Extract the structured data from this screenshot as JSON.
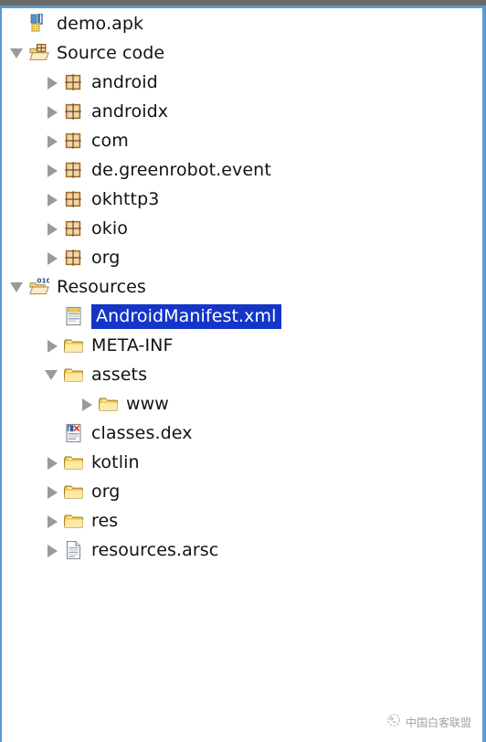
{
  "window": {
    "title": "demo.apk",
    "accent_color": "#5b9bd5",
    "titlebar_color": "#6a6a6a",
    "background": "#ffffff"
  },
  "selection": {
    "highlight_color": "#1535c8",
    "text_color": "#ffffff",
    "selected_label": "AndroidManifest.xml"
  },
  "tree": {
    "rows": [
      {
        "label": "demo.apk",
        "icon": "apk-file-icon",
        "depth": 0,
        "twisty": "none",
        "selected": false
      },
      {
        "label": "Source code",
        "icon": "package-folder-open-icon",
        "depth": 0,
        "twisty": "expanded",
        "selected": false
      },
      {
        "label": "android",
        "icon": "package-icon",
        "depth": 1,
        "twisty": "collapsed",
        "selected": false
      },
      {
        "label": "androidx",
        "icon": "package-icon",
        "depth": 1,
        "twisty": "collapsed",
        "selected": false
      },
      {
        "label": "com",
        "icon": "package-icon",
        "depth": 1,
        "twisty": "collapsed",
        "selected": false
      },
      {
        "label": "de.greenrobot.event",
        "icon": "package-icon",
        "depth": 1,
        "twisty": "collapsed",
        "selected": false
      },
      {
        "label": "okhttp3",
        "icon": "package-icon",
        "depth": 1,
        "twisty": "collapsed",
        "selected": false
      },
      {
        "label": "okio",
        "icon": "package-icon",
        "depth": 1,
        "twisty": "collapsed",
        "selected": false
      },
      {
        "label": "org",
        "icon": "package-icon",
        "depth": 1,
        "twisty": "collapsed",
        "selected": false
      },
      {
        "label": "Resources",
        "icon": "binary-folder-open-icon",
        "depth": 0,
        "twisty": "expanded",
        "selected": false
      },
      {
        "label": "AndroidManifest.xml",
        "icon": "xml-file-icon",
        "depth": 1,
        "twisty": "none",
        "selected": true
      },
      {
        "label": "META-INF",
        "icon": "folder-icon",
        "depth": 1,
        "twisty": "collapsed",
        "selected": false
      },
      {
        "label": "assets",
        "icon": "folder-icon",
        "depth": 1,
        "twisty": "expanded",
        "selected": false
      },
      {
        "label": "www",
        "icon": "folder-icon",
        "depth": 2,
        "twisty": "collapsed",
        "selected": false
      },
      {
        "label": "classes.dex",
        "icon": "dex-file-icon",
        "depth": 1,
        "twisty": "none",
        "selected": false
      },
      {
        "label": "kotlin",
        "icon": "folder-icon",
        "depth": 1,
        "twisty": "collapsed",
        "selected": false
      },
      {
        "label": "org",
        "icon": "folder-icon",
        "depth": 1,
        "twisty": "collapsed",
        "selected": false
      },
      {
        "label": "res",
        "icon": "folder-icon",
        "depth": 1,
        "twisty": "collapsed",
        "selected": false
      },
      {
        "label": "resources.arsc",
        "icon": "document-file-icon",
        "depth": 1,
        "twisty": "collapsed",
        "selected": false
      }
    ]
  },
  "watermark": {
    "text": "中国白客联盟",
    "icon": "circular-logo-icon"
  }
}
